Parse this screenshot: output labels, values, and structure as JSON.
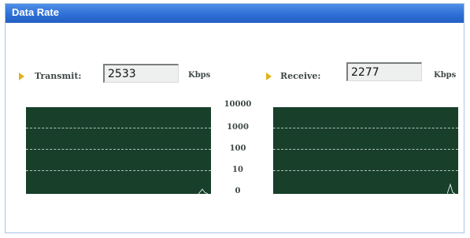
{
  "window": {
    "title": "Data Rate"
  },
  "transmit": {
    "label": "Transmit:",
    "value": "2533",
    "unit": "Kbps"
  },
  "receive": {
    "label": "Receive:",
    "value": "2277",
    "unit": "Kbps"
  },
  "scale": {
    "ticks": [
      "10000",
      "1000",
      "100",
      "10",
      "0"
    ]
  },
  "colors": {
    "graph_bg": "#173f2a",
    "titlebar": "#2e6fd6",
    "arrow": "#e2b21a"
  }
}
